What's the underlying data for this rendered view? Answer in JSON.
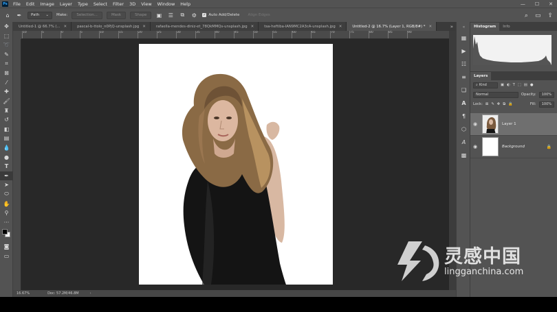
{
  "app": {
    "logo": "Ps"
  },
  "menu": [
    "File",
    "Edit",
    "Image",
    "Layer",
    "Type",
    "Select",
    "Filter",
    "3D",
    "View",
    "Window",
    "Help"
  ],
  "window_controls": {
    "minimize": "—",
    "maximize": "☐",
    "close": "✕"
  },
  "options": {
    "tool_mode": "Path",
    "make_label": "Make:",
    "selection_btn": "Selection...",
    "mask_btn": "Mask",
    "shape_btn": "Shape",
    "auto_add_delete": "Auto Add/Delete",
    "align_edges": "Align Edges"
  },
  "tabs": [
    {
      "label": "Untitled-1 @ 66.7% (...",
      "active": false
    },
    {
      "label": "pascal-b-ttolo_n0PjQ-unsplash.jpg",
      "active": false
    },
    {
      "label": "rafaella-mendes-diniz-et_78QkMMQs-unsplash.jpg",
      "active": false
    },
    {
      "label": "tsa-heftiba-IAN9MC2A3cA-unsplash.jpg",
      "active": false
    },
    {
      "label": "Untitled-2 @ 16.7% (Layer 1, RGB/8#) *",
      "active": true
    }
  ],
  "tab_overflow": "»",
  "ruler_labels": [
    "10",
    "5",
    "0",
    "5",
    "10",
    "15",
    "20",
    "25",
    "30",
    "35",
    "40",
    "45",
    "50",
    "55",
    "60",
    "65",
    "70",
    "75",
    "80",
    "85",
    "90"
  ],
  "status": {
    "zoom": "16.67%",
    "doc": "Doc: 57.2M/46.8M"
  },
  "panels": {
    "histogram_tab": "Histogram",
    "info_tab": "Info",
    "layers_tab": "Layers",
    "kind": "Kind",
    "blend_mode": "Normal",
    "opacity_label": "Opacity:",
    "opacity_value": "100%",
    "lock_label": "Lock:",
    "fill_label": "Fill:",
    "fill_value": "100%"
  },
  "layers": [
    {
      "name": "Layer 1",
      "selected": true,
      "visible": true,
      "locked": false
    },
    {
      "name": "Background",
      "selected": false,
      "visible": true,
      "locked": true
    }
  ],
  "watermark": {
    "cn": "灵感中国",
    "url": "lingganchina.com"
  },
  "colors": {
    "ui": "#535353",
    "canvas_bg": "#282828",
    "doc": "#ffffff"
  }
}
